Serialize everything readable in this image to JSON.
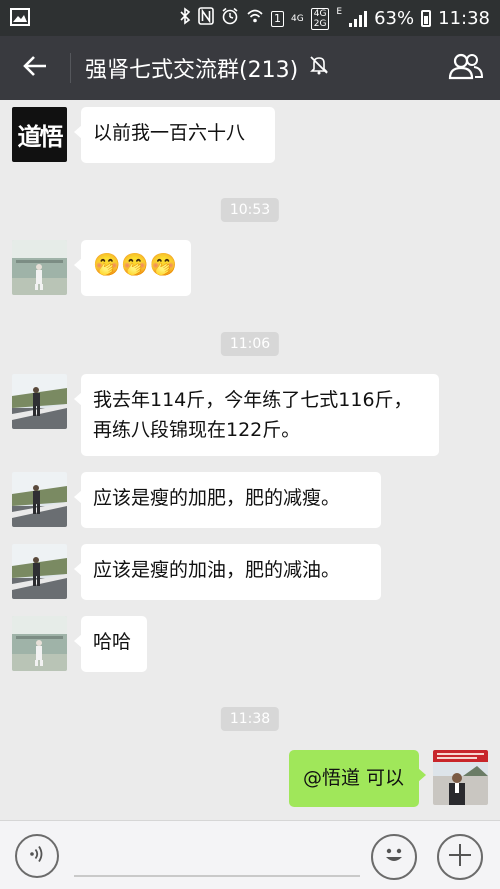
{
  "status_bar": {
    "network_small_top": "4G",
    "network_4g2g_top": "4G",
    "network_4g2g_bottom": "2G",
    "edge_label": "E",
    "sim_number": "1",
    "battery_percent": "63%",
    "time": "11:38",
    "battery_level": 0.63
  },
  "title_bar": {
    "title": "强肾七式交流群(213)",
    "icons": [
      "back-arrow-icon",
      "mute-bell-icon",
      "group-members-icon"
    ]
  },
  "messages": [
    {
      "type": "incoming",
      "avatar": "avatar-calligraphy",
      "text": "以前我一百六十八",
      "avatar_text": "道悟"
    },
    {
      "type": "time",
      "text": "10:53"
    },
    {
      "type": "incoming",
      "avatar": "avatar-bridge-photo",
      "text": "🤭🤭🤭"
    },
    {
      "type": "time",
      "text": "11:06"
    },
    {
      "type": "incoming",
      "avatar": "avatar-roadside-man",
      "text": "我去年114斤，今年练了七式116斤，再练八段锦现在122斤。"
    },
    {
      "type": "incoming",
      "avatar": "avatar-roadside-man",
      "text": "应该是瘦的加肥，肥的减瘦。"
    },
    {
      "type": "incoming",
      "avatar": "avatar-roadside-man",
      "text": "应该是瘦的加油，肥的减油。"
    },
    {
      "type": "incoming",
      "avatar": "avatar-bridge-photo",
      "text": "哈哈"
    },
    {
      "type": "time",
      "text": "11:38"
    },
    {
      "type": "outgoing",
      "avatar": "avatar-self-photo",
      "text": "@悟道 可以"
    }
  ],
  "input_bar": {
    "placeholder": "",
    "icons": [
      "voice-icon",
      "emoji-icon",
      "plus-icon"
    ]
  },
  "colors": {
    "status_bar_bg": "#2e3132",
    "title_bar_bg": "#393a3f",
    "chat_bg": "#ebebeb",
    "outgoing_bubble": "#a0e75a",
    "incoming_bubble": "#ffffff"
  }
}
